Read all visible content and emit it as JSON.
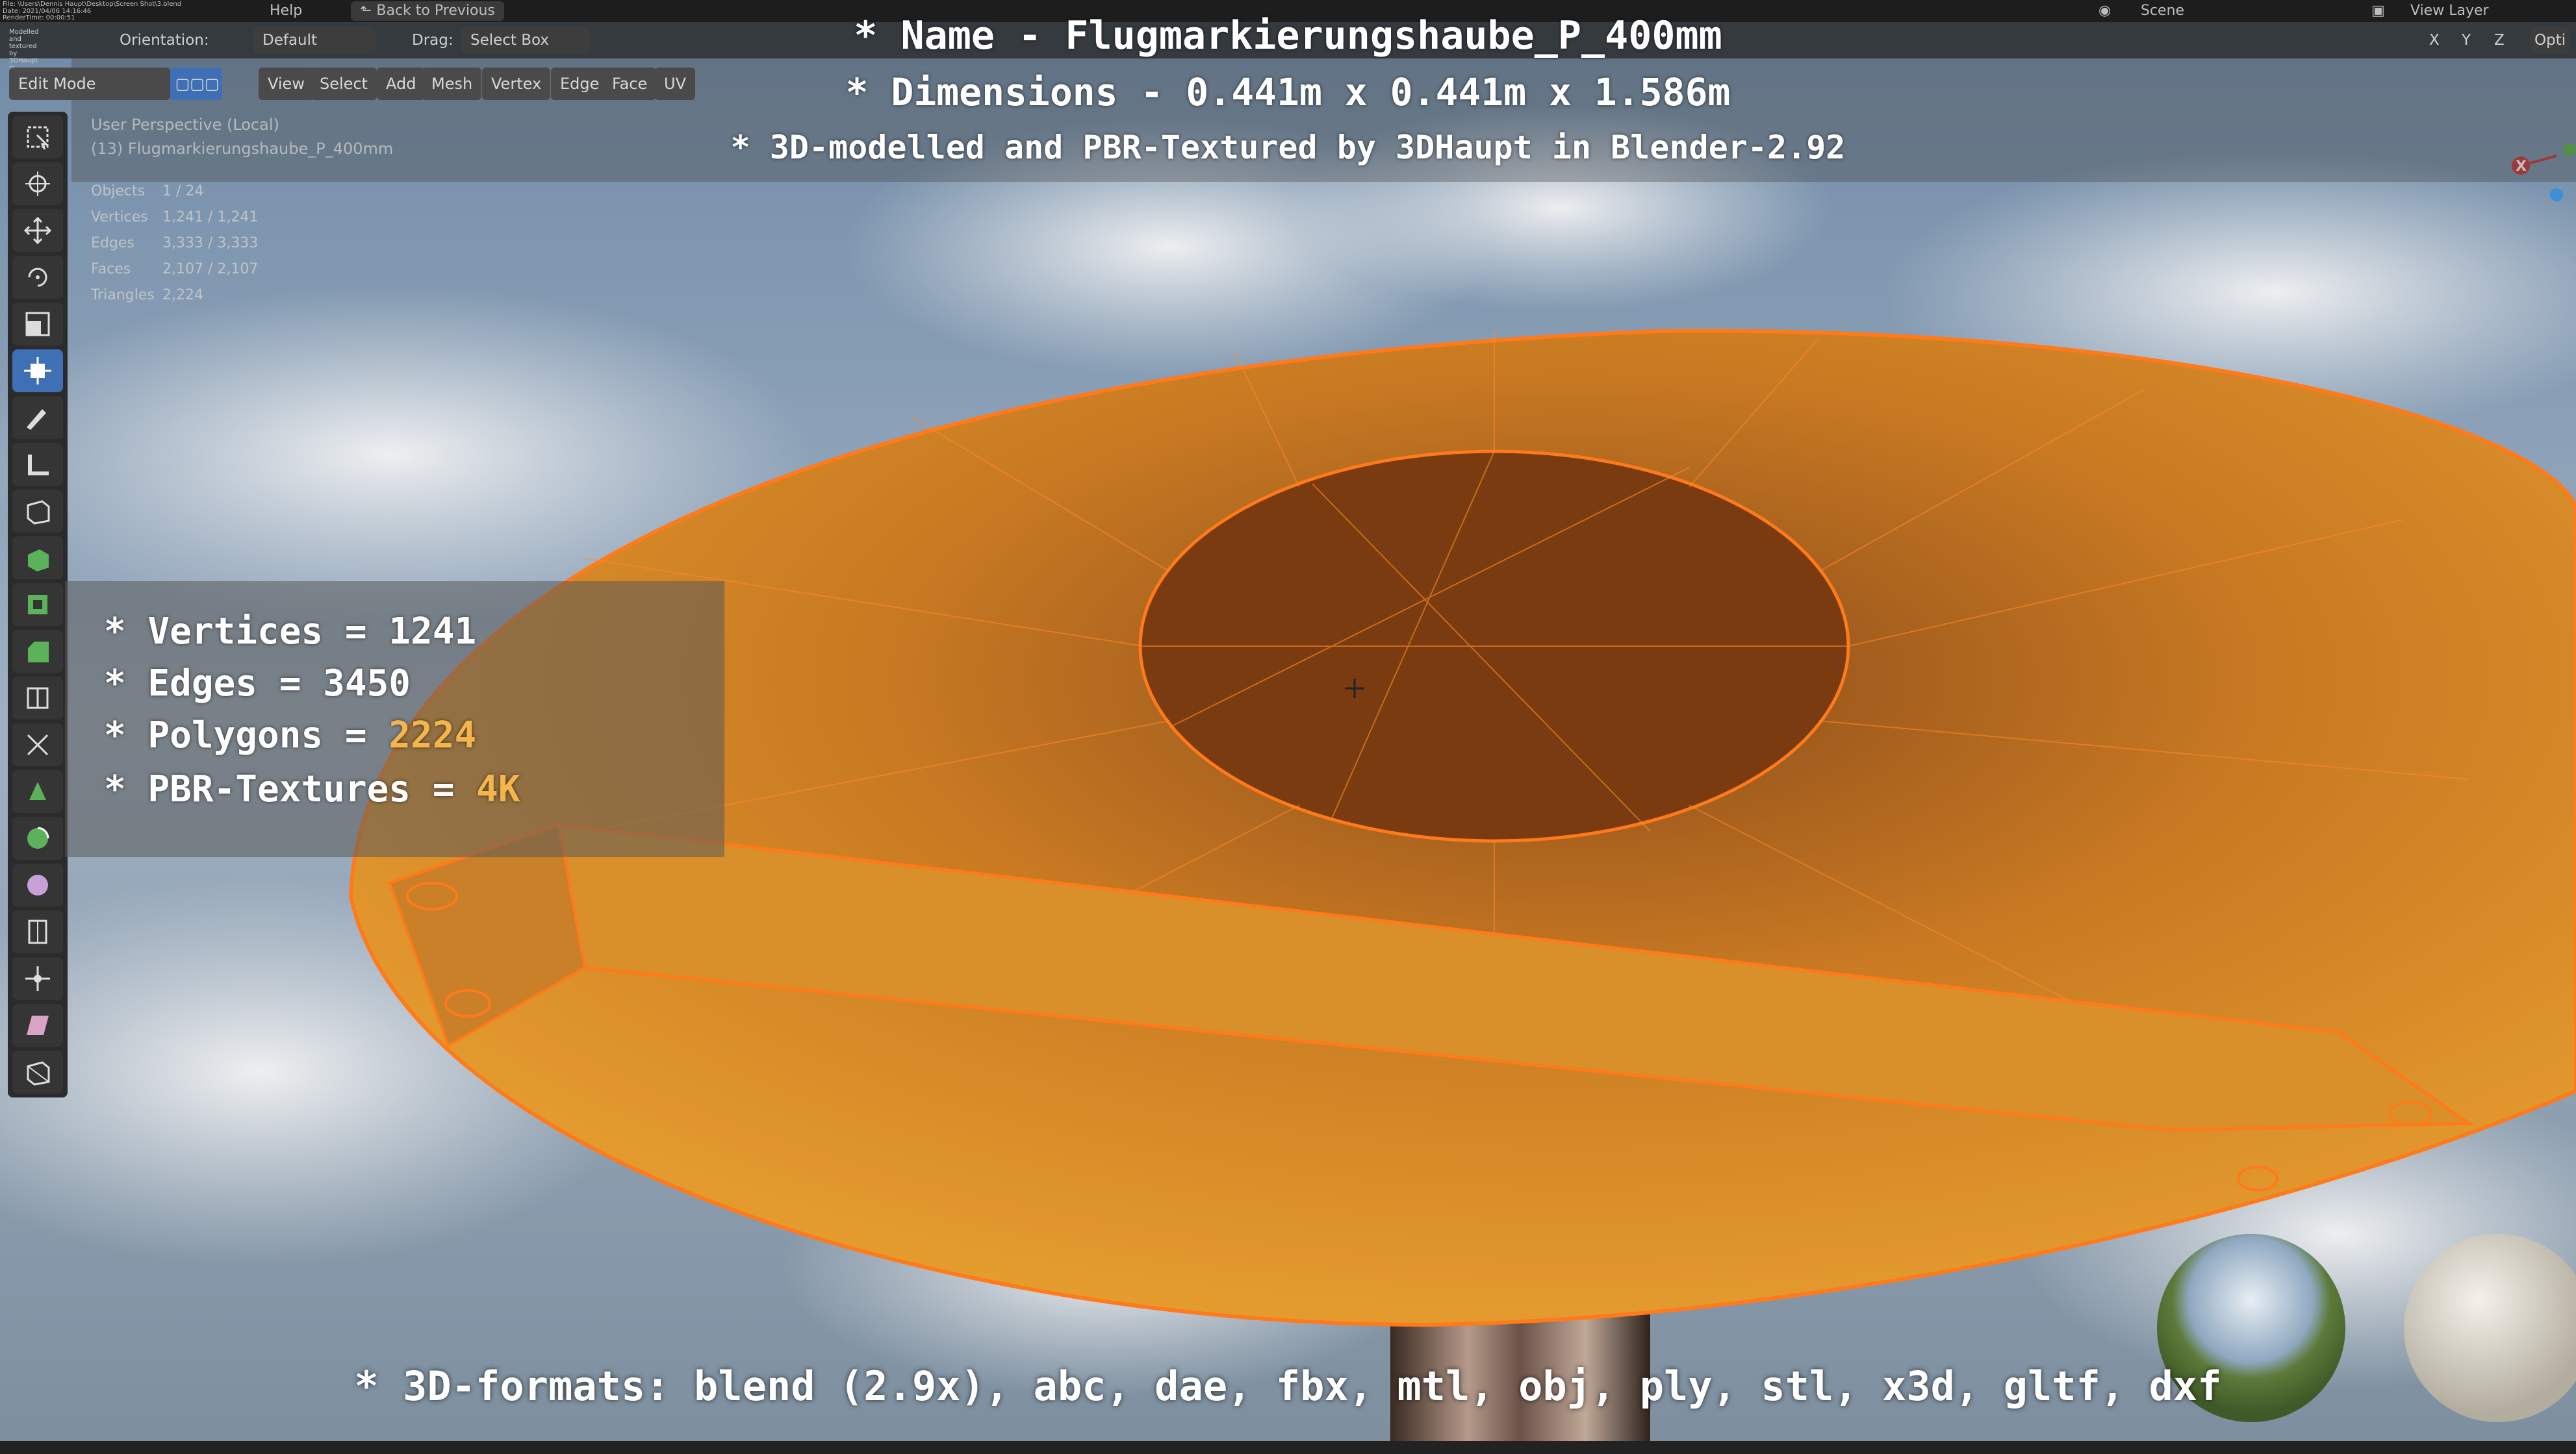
{
  "topbar": {
    "file_path": "File: \\Users\\Dennis Haupt\\Desktop\\Screen Shot\\3.blend",
    "date_line": "Date: 2021/04/06  14:16:46",
    "render_time": "RenderTime: 00:00:51",
    "modelled_line": "Modelled and textured by 3DHaupt in Blender-2.91",
    "menu": [
      "Help"
    ],
    "back_button": "Back to Previous",
    "scene_label": "Scene",
    "view_layer_label": "View Layer"
  },
  "header": {
    "orientation_label": "Orientation:",
    "pivot_value": "Default",
    "drag_label": "Drag:",
    "drag_value": "Select Box",
    "mode": "Edit Mode",
    "menus": [
      "View",
      "Select",
      "Add",
      "Mesh",
      "Vertex",
      "Edge",
      "Face",
      "UV"
    ],
    "axis_buttons": [
      "X",
      "Y",
      "Z"
    ],
    "options_label": "Opti"
  },
  "viewport_info": {
    "perspective": "User Perspective (Local)",
    "object_name": "(13) Flugmarkierungshaube_P_400mm",
    "stats": [
      {
        "label": "Objects",
        "value": "1 / 24"
      },
      {
        "label": "Vertices",
        "value": "1,241 / 1,241"
      },
      {
        "label": "Edges",
        "value": "3,333 / 3,333"
      },
      {
        "label": "Faces",
        "value": "2,107 / 2,107"
      },
      {
        "label": "Triangles",
        "value": "2,224"
      }
    ]
  },
  "overlay_titles": {
    "name_line": "* Name - Flugmarkierungshaube_P_400mm",
    "dimensions_line": "* Dimensions -  0.441m x 0.441m x 1.586m",
    "credit_line": "* 3D-modelled and PBR-Textured by 3DHaupt in Blender-2.92"
  },
  "overlay_stats": {
    "vertices": "* Vertices = 1241",
    "edges": "* Edges = 3450",
    "polygons_prefix": "* Polygons = ",
    "polygons_value": "2224",
    "textures_prefix": "* PBR-Textures = ",
    "textures_value": "4K"
  },
  "formats_line": "* 3D-formats: blend (2.9x), abc, dae, fbx, mtl, obj, ply, stl, x3d, gltf, dxf",
  "gizmo": {
    "x_label": "X"
  },
  "colors": {
    "mesh_orange": "#e8a030",
    "edge_orange": "#ff7a1a",
    "highlight": "#f4b64a",
    "active_tool": "#3f6fb5"
  },
  "tools": [
    "select-box-icon",
    "cursor-icon",
    "move-icon",
    "rotate-icon",
    "scale-icon",
    "transform-icon",
    "annotate-icon",
    "measure-icon",
    "add-cube-icon",
    "extrude-icon",
    "inset-icon",
    "bevel-icon",
    "loop-cut-icon",
    "knife-icon",
    "poly-build-icon",
    "spin-icon",
    "smooth-icon",
    "edge-slide-icon",
    "shrink-icon",
    "shear-icon",
    "rip-icon"
  ]
}
